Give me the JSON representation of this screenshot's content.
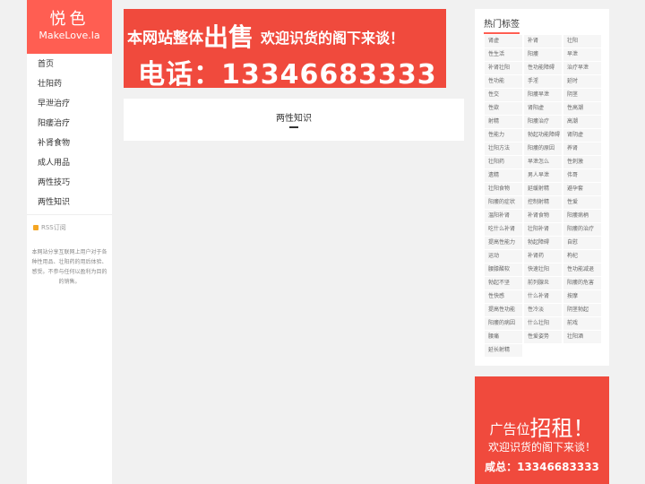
{
  "logo": {
    "cn": "悦色",
    "en": "MakeLove.la"
  },
  "nav": [
    "首页",
    "壮阳药",
    "早泄治疗",
    "阳痿治疗",
    "补肾食物",
    "成人用品",
    "两性技巧",
    "两性知识"
  ],
  "rss": "RSS订阅",
  "description": "本网站分享互联网上用户对于各种性用品、壮阳药的用后体验、感受。不参与任何以盈利为目的的销售。",
  "banner": {
    "prefix": "本网站整体",
    "big": "出售",
    "suffix": "欢迎识货的阁下来谈！",
    "phone": "电话：13346683333"
  },
  "section_title": "两性知识",
  "hot_tags": {
    "title": "热门标签",
    "items": [
      "肾虚",
      "补肾",
      "壮阳",
      "性生活",
      "阳痿",
      "早泄",
      "补肾壮阳",
      "性功能障碍",
      "治疗早泄",
      "性功能",
      "手淫",
      "延时",
      "性交",
      "阳痿早泄",
      "阴茎",
      "性欲",
      "肾阳虚",
      "性高潮",
      "射精",
      "阳痿治疗",
      "高潮",
      "性能力",
      "勃起功能障碍",
      "肾阴虚",
      "壮阳方法",
      "阳痿的原因",
      "养肾",
      "壮阳药",
      "早泄怎么",
      "性刺激",
      "遗精",
      "男人早泄",
      "伟哥",
      "壮阳食物",
      "延缓射精",
      "避孕套",
      "阳痿的症状",
      "控制射精",
      "性爱",
      "温阳补肾",
      "补肾食物",
      "阳痿病柄",
      "吃什么补肾",
      "壮阳补肾",
      "阳痿的治疗",
      "提高性能力",
      "勃起障碍",
      "自慰",
      "运动",
      "补肾药",
      "枸杞",
      "腰膝酸软",
      "快速壮阳",
      "性功能减退",
      "勃起不坚",
      "前列腺炎",
      "阳痿的危害",
      "性快感",
      "什么补肾",
      "按摩",
      "提高性功能",
      "性冷淡",
      "阴茎勃起",
      "阳痿的病因",
      "什么壮阳",
      "前戏",
      "腰痛",
      "性爱姿势",
      "壮阳酒",
      "延长射精"
    ]
  },
  "ad": {
    "prefix": "广告位",
    "big": "招租！",
    "line2": "欢迎识货的阁下来谈！",
    "line3": "咸总：13346683333"
  }
}
